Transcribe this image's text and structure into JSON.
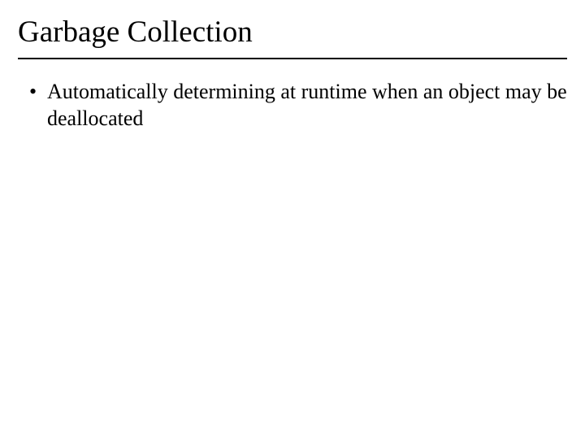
{
  "slide": {
    "title": "Garbage Collection",
    "bullets": [
      "Automatically determining at runtime when an object may be deallocated"
    ]
  }
}
